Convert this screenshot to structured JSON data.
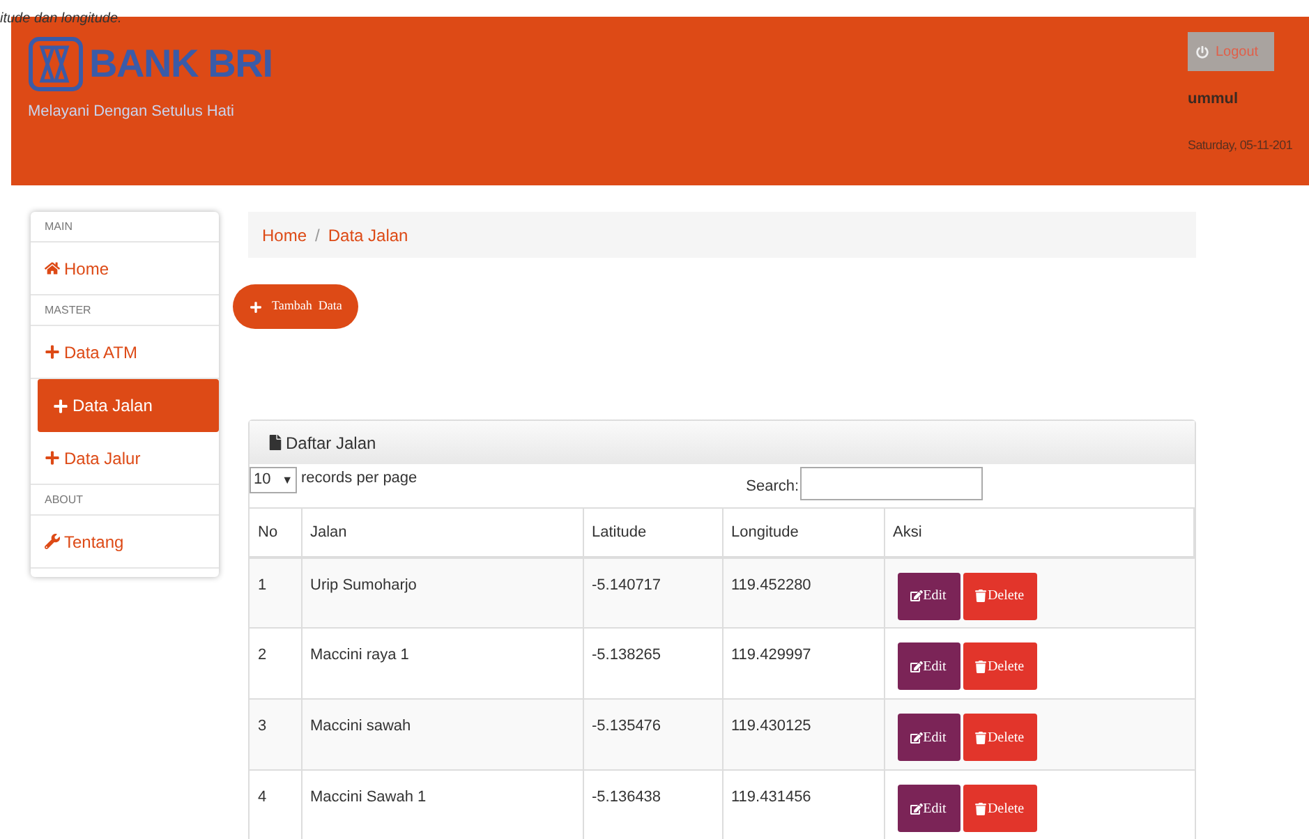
{
  "caption": "itude dan longitude.",
  "header": {
    "logo_text": "BANK BRI",
    "tagline": "Melayani Dengan Setulus Hati",
    "logout": "Logout",
    "user": "ummul",
    "date": "Saturday, 05-11-201"
  },
  "sidebar": [
    {
      "kind": "heading",
      "label": "MAIN"
    },
    {
      "kind": "home",
      "label": "Home",
      "selected": false
    },
    {
      "kind": "heading",
      "label": "MASTER"
    },
    {
      "kind": "add",
      "label": "Data ATM",
      "selected": false
    },
    {
      "kind": "add",
      "label": "Data Jalan",
      "selected": true
    },
    {
      "kind": "add",
      "label": "Data Jalur",
      "selected": false
    },
    {
      "kind": "heading",
      "label": "ABOUT"
    },
    {
      "kind": "tool",
      "label": "Tentang",
      "selected": false
    }
  ],
  "breadcrumb": [
    "Home",
    "Data Jalan"
  ],
  "breadcrumb_separator": "/",
  "add_button": "Tambah  Data",
  "panel": {
    "title": "Daftar Jalan",
    "page_size": "10",
    "dropdown_arrow": "▼",
    "records_label": "records per page",
    "search_label": "Search:",
    "columns": [
      "No",
      "Jalan",
      "Latitude",
      "Longitude",
      "Aksi"
    ],
    "rows": [
      {
        "no": "1",
        "jalan": "Urip Sumoharjo",
        "lat": "-5.140717",
        "lng": "119.452280",
        "edit": "Edit",
        "delete": "Delete"
      },
      {
        "no": "2",
        "jalan": "Maccini raya 1",
        "lat": "-5.138265",
        "lng": "119.429997",
        "edit": "Edit",
        "delete": "Delete"
      },
      {
        "no": "3",
        "jalan": "Maccini sawah",
        "lat": "-5.135476",
        "lng": "119.430125",
        "edit": "Edit",
        "delete": "Delete"
      },
      {
        "no": "4",
        "jalan": "Maccini Sawah 1",
        "lat": "-5.136438",
        "lng": "119.431456",
        "edit": "Edit",
        "delete": "Delete"
      }
    ]
  }
}
